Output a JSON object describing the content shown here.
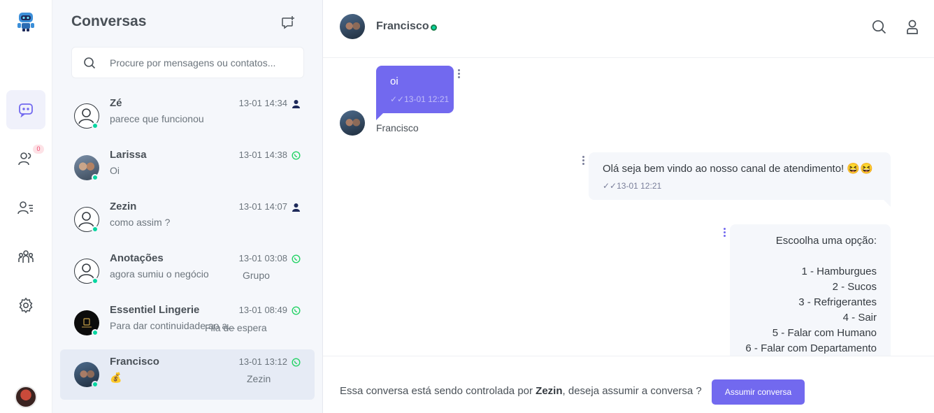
{
  "sidebar": {
    "icons": [
      "robot-logo-icon",
      "chat-icon",
      "contacts-icon",
      "user-list-icon",
      "groups-icon",
      "settings-icon"
    ],
    "contacts_badge": "0"
  },
  "conversations_panel": {
    "title": "Conversas",
    "search_placeholder": "Procure por mensagens ou contatos...",
    "items": [
      {
        "name": "Zé",
        "preview": "parece que funcionou",
        "time": "13-01 14:34",
        "channel": "user-icon",
        "tag": ""
      },
      {
        "name": "Larissa",
        "preview": "Oi",
        "time": "13-01 14:38",
        "channel": "whatsapp-icon",
        "tag": ""
      },
      {
        "name": "Zezin",
        "preview": "como assim ?",
        "time": "13-01 14:07",
        "channel": "user-icon",
        "tag": ""
      },
      {
        "name": "Anotações",
        "preview": "agora sumiu o negócio",
        "time": "13-01 03:08",
        "channel": "whatsapp-icon",
        "tag": "Grupo"
      },
      {
        "name": "Essentiel Lingerie",
        "preview": "Para dar continuidade ao a...",
        "time": "13-01 08:49",
        "channel": "whatsapp-icon",
        "tag": "Fila de espera"
      },
      {
        "name": "Francisco",
        "preview": "💰",
        "time": "13-01 13:12",
        "channel": "whatsapp-icon",
        "tag": "Zezin"
      }
    ]
  },
  "chat": {
    "contact_name": "Francisco",
    "messages": [
      {
        "text": "oi",
        "time": "13-01 12:21",
        "sender": "Francisco"
      },
      {
        "text": "Olá seja bem vindo ao nosso canal de atendimento! 😆😆",
        "time": "13-01 12:21"
      },
      {
        "text": "Escoolha uma opção:\n\n1 - Hamburgues\n2 - Sucos\n3 - Refrigerantes\n4 - Sair\n5 - Falar com Humano\n6 - Falar com Departamento"
      }
    ],
    "footer": {
      "prefix": "Essa conversa está sendo controlada por ",
      "agent": "Zezin",
      "suffix": ", deseja assumir a conversa ?",
      "button_label": "Assumir conversa"
    }
  },
  "colors": {
    "accent": "#7269ef",
    "online": "#06d6a0",
    "whatsapp": "#25d366"
  }
}
